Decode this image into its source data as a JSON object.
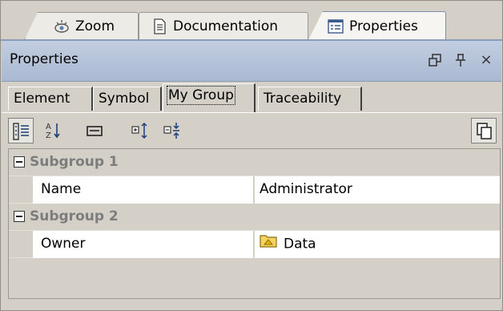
{
  "top_tabs": [
    {
      "label": "Zoom",
      "icon": "zoom-eye-icon"
    },
    {
      "label": "Documentation",
      "icon": "document-icon"
    },
    {
      "label": "Properties",
      "icon": "properties-icon",
      "active": true
    }
  ],
  "panel": {
    "title": "Properties",
    "controls": [
      "restore-icon",
      "pin-icon",
      "close-icon"
    ],
    "close_glyph": "×"
  },
  "sub_tabs": [
    {
      "label": "Element"
    },
    {
      "label": "Symbol"
    },
    {
      "label": "My Group",
      "active": true
    },
    {
      "label": "Traceability"
    }
  ],
  "toolbar": {
    "tools": [
      "categorized-view-icon",
      "alphabetic-sort-icon",
      "description-icon",
      "expand-all-icon",
      "collapse-all-icon"
    ],
    "right_tool": "copy-icon"
  },
  "groups": [
    {
      "name": "Subgroup 1",
      "expanded": true,
      "props": [
        {
          "name": "Name",
          "value": "Administrator"
        }
      ]
    },
    {
      "name": "Subgroup 2",
      "expanded": true,
      "props": [
        {
          "name": "Owner",
          "value": "Data",
          "value_icon": "package-folder-icon"
        }
      ]
    }
  ],
  "colors": {
    "title_bar": "#b4c2d8",
    "group_text": "#7d7d7d",
    "panel_bg": "#d4d0c8"
  }
}
